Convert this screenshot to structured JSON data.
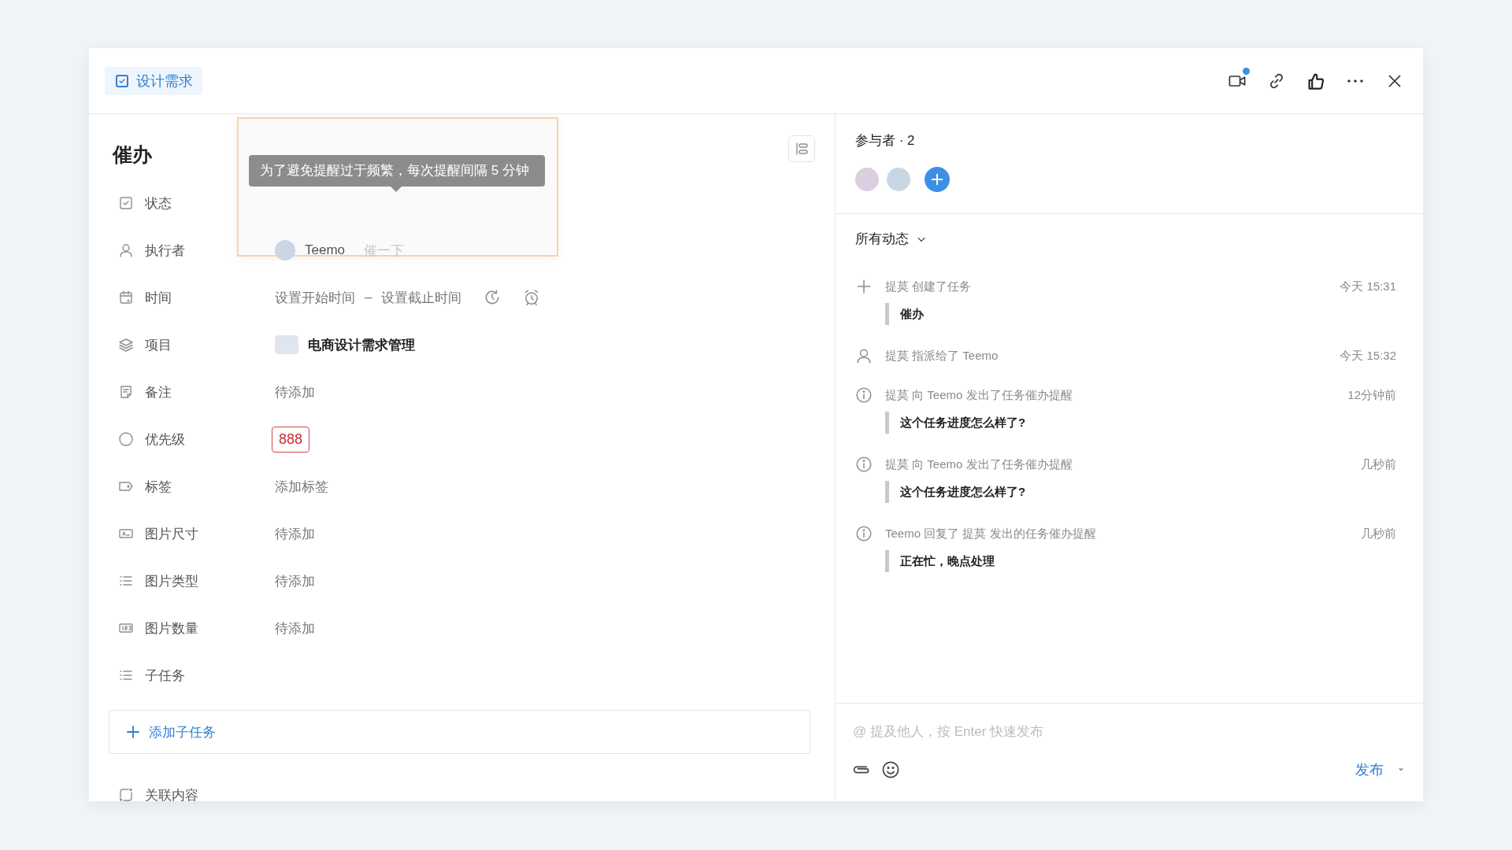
{
  "header": {
    "tag": "设计需求",
    "video_notification": true
  },
  "task": {
    "title": "催办"
  },
  "fields": [
    {
      "kind": "status",
      "label": "状态"
    },
    {
      "kind": "assignee",
      "label": "执行者",
      "name": "Teemo",
      "action": "催一下"
    },
    {
      "kind": "time",
      "label": "时间",
      "start": "设置开始时间",
      "separator": "–",
      "end": "设置截止时间"
    },
    {
      "kind": "project",
      "label": "项目",
      "value": "电商设计需求管理"
    },
    {
      "kind": "text",
      "label": "备注",
      "placeholder": "待添加"
    },
    {
      "kind": "priority",
      "label": "优先级",
      "value": "888"
    },
    {
      "kind": "text",
      "label": "标签",
      "placeholder": "添加标签"
    },
    {
      "kind": "text",
      "label": "图片尺寸",
      "placeholder": "待添加"
    },
    {
      "kind": "text",
      "label": "图片类型",
      "placeholder": "待添加"
    },
    {
      "kind": "text",
      "label": "图片数量",
      "placeholder": "待添加"
    },
    {
      "kind": "subtasks",
      "label": "子任务"
    }
  ],
  "tooltip": "为了避免提醒过于频繁，每次提醒间隔 5 分钟",
  "add_subtask": "添加子任务",
  "related": "关联内容",
  "participants": {
    "title": "参与者 · 2"
  },
  "activity": {
    "filter": "所有动态",
    "items": [
      {
        "kind": "create",
        "text": "提莫 创建了任务",
        "time": "今天 15:31",
        "quote": "催办"
      },
      {
        "kind": "assign",
        "text": "提莫 指派给了 Teemo",
        "time": "今天 15:32"
      },
      {
        "kind": "info",
        "text": "提莫 向 Teemo 发出了任务催办提醒",
        "time": "12分钟前",
        "quote": "这个任务进度怎么样了?"
      },
      {
        "kind": "info",
        "text": "提莫 向 Teemo 发出了任务催办提醒",
        "time": "几秒前",
        "quote": "这个任务进度怎么样了?"
      },
      {
        "kind": "info",
        "text": "Teemo 回复了 提莫 发出的任务催办提醒",
        "time": "几秒前",
        "quote": "正在忙，晚点处理"
      }
    ]
  },
  "comment": {
    "placeholder": "@ 提及他人，按 Enter 快速发布",
    "submit": "发布"
  }
}
